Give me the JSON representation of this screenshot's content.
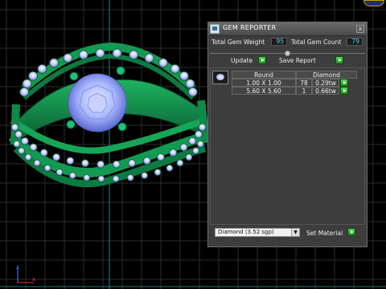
{
  "panel": {
    "title": "GEM REPORTER",
    "close_label": "x",
    "total_weight_label": "Total Gem Weight",
    "total_weight_value": "95",
    "total_count_label": "Total Gem Count",
    "total_count_value": "79",
    "update_label": "Update",
    "save_report_label": "Save Report"
  },
  "table": {
    "headers": [
      "Round",
      "Diamond"
    ],
    "rows": [
      {
        "size": "1.00 X 1.00",
        "count": "78",
        "weight": "0.29tw"
      },
      {
        "size": "5.60 X 5.60",
        "count": "1",
        "weight": "0.66tw"
      }
    ]
  },
  "material": {
    "selected": "Diamond     (3.52 sgp)",
    "set_label": "Set Material"
  },
  "colors": {
    "viewport_bg": "#000000",
    "grid": "#2f2f2f",
    "ring_green": "#0f8a4a",
    "gem": "#a9b7ff",
    "panel_bg": "#3d3d3d",
    "value_text": "#4fd0e6",
    "go_button": "#2eaa2e"
  },
  "icons": {
    "panel_icon": "gem-reporter-icon",
    "button_icon": "play-arrow-icon",
    "axis": "axis-gizmo-icon"
  }
}
